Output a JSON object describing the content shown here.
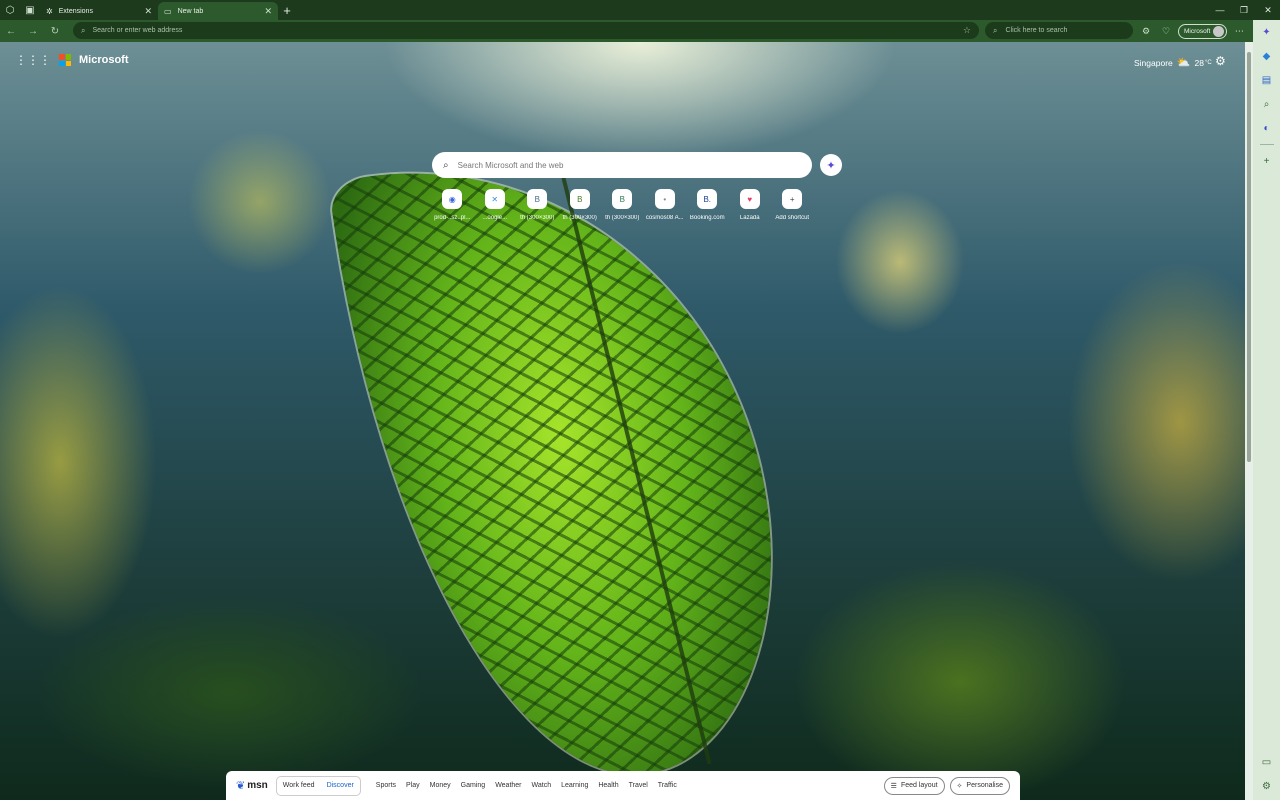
{
  "tabs": [
    {
      "label": "Extensions",
      "icon": "puzzle-icon"
    },
    {
      "label": "New tab",
      "icon": "page-icon",
      "active": true
    }
  ],
  "address_bar": {
    "placeholder": "Search or enter web address"
  },
  "side_search": {
    "placeholder": "Click here to search"
  },
  "profile": {
    "label": "Microsoft"
  },
  "page": {
    "brand": "Microsoft",
    "weather": {
      "location": "Singapore",
      "temp": "28",
      "unit": "°C"
    },
    "search_placeholder": "Search Microsoft and the web"
  },
  "shortcuts": [
    {
      "label": "prod-..sz..pl...",
      "glyph": "◉",
      "color": "#3a66e0"
    },
    {
      "label": "...oogle...",
      "glyph": "✕",
      "color": "#3b8fd6"
    },
    {
      "label": "th (300×300)",
      "glyph": "B",
      "color": "#4a6a88"
    },
    {
      "label": "th (300×300)",
      "glyph": "B",
      "color": "#4b7a2a"
    },
    {
      "label": "th (300×300)",
      "glyph": "B",
      "color": "#2f7a55"
    },
    {
      "label": "cosmos08 A...",
      "glyph": "•",
      "color": "#888"
    },
    {
      "label": "Booking.com",
      "glyph": "B.",
      "color": "#1a3f8a"
    },
    {
      "label": "Lazada",
      "glyph": "♥",
      "color": "#e0406a"
    },
    {
      "label": "Add shortcut",
      "glyph": "+",
      "color": "#444"
    }
  ],
  "msn": {
    "logo": "msn",
    "feed_tabs": [
      "Work feed",
      "Discover"
    ],
    "categories": [
      "Sports",
      "Play",
      "Money",
      "Gaming",
      "Weather",
      "Watch",
      "Learning",
      "Health",
      "Travel",
      "Traffic"
    ],
    "feed_layout": "Feed layout",
    "personalise": "Personalise"
  },
  "colors": {
    "frame": "#1d3a1d",
    "toolbar": "#2c5a2c",
    "accent": "#1a62c9"
  }
}
